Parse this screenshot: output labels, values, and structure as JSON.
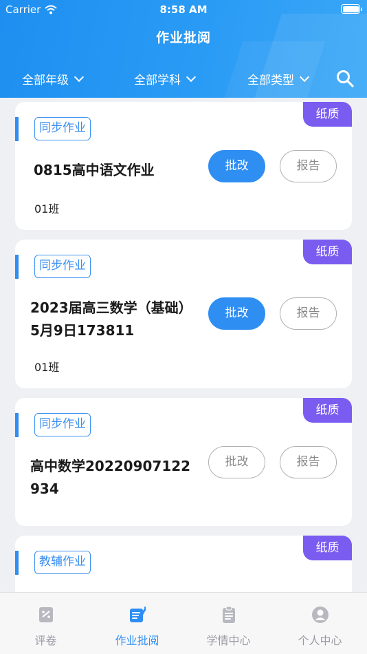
{
  "status_bar": {
    "carrier": "Carrier",
    "time": "8:58 AM"
  },
  "header": {
    "title": "作业批阅",
    "filters": [
      {
        "label": "全部年级"
      },
      {
        "label": "全部学科"
      },
      {
        "label": "全部类型"
      }
    ]
  },
  "assignments": [
    {
      "tag": "同步作业",
      "type_badge": "纸质",
      "name": "0815高中语文作业",
      "class": "01班",
      "grade_label": "批改",
      "grade_active": true,
      "report_label": "报告"
    },
    {
      "tag": "同步作业",
      "type_badge": "纸质",
      "name": "2023届高三数学（基础）5月9日173811",
      "class": "01班",
      "grade_label": "批改",
      "grade_active": true,
      "report_label": "报告"
    },
    {
      "tag": "同步作业",
      "type_badge": "纸质",
      "name": "高中数学20220907122934",
      "class": "",
      "grade_label": "批改",
      "grade_active": false,
      "report_label": "报告"
    },
    {
      "tag": "教辅作业",
      "type_badge": "纸质",
      "name": "",
      "class": "",
      "grade_label": "",
      "grade_active": false,
      "report_label": ""
    }
  ],
  "tabbar": {
    "tabs": [
      {
        "label": "评卷",
        "icon": "paper-grade-icon",
        "active": false
      },
      {
        "label": "作业批阅",
        "icon": "homework-edit-icon",
        "active": true
      },
      {
        "label": "学情中心",
        "icon": "clipboard-icon",
        "active": false
      },
      {
        "label": "个人中心",
        "icon": "user-icon",
        "active": false
      }
    ]
  },
  "colors": {
    "primary": "#2f8ef2",
    "badge": "#7a5cf0",
    "header_start": "#1e8ff0",
    "header_end": "#3aa7f7"
  }
}
